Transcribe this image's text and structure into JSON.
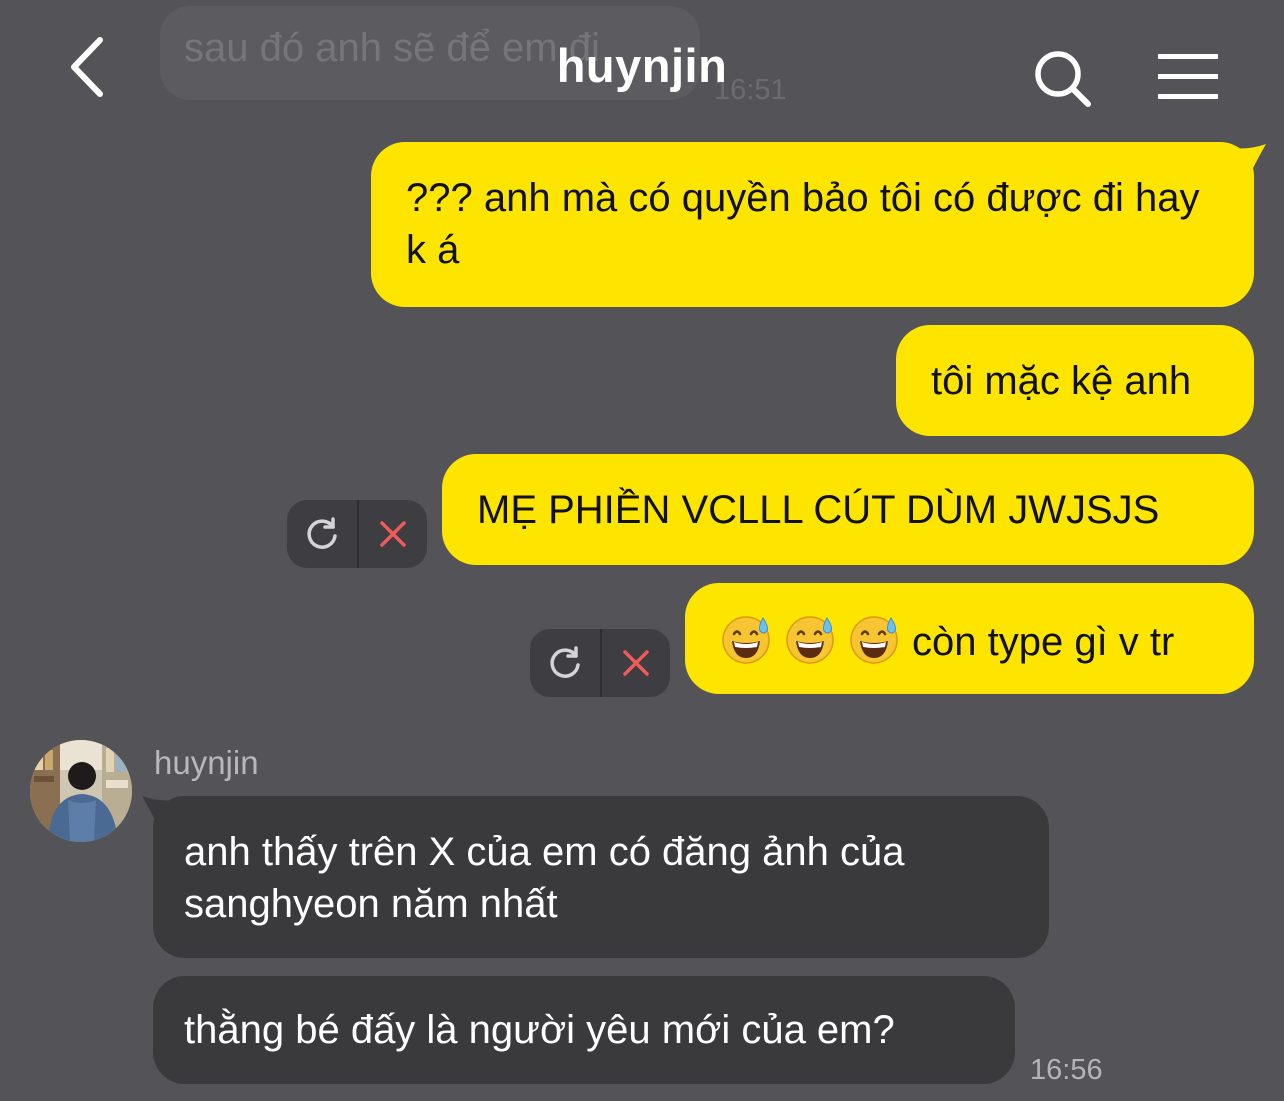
{
  "header": {
    "title": "huynjin",
    "back_icon": "chevron-left-icon",
    "search_icon": "search-icon",
    "menu_icon": "hamburger-menu-icon"
  },
  "previous_message": {
    "text": "sau đó anh sẽ để em đi",
    "time": "16:51"
  },
  "outgoing": [
    {
      "text": "??? anh mà có quyền bảo tôi có được đi hay k á",
      "failed": false
    },
    {
      "text": "tôi mặc kệ anh",
      "failed": false
    },
    {
      "text": "MẸ PHIỀN VCLLL CÚT DÙM JWJSJS",
      "failed": true
    },
    {
      "emoji": [
        "grinning-sweat-emoji",
        "grinning-sweat-emoji",
        "grinning-sweat-emoji"
      ],
      "text": "còn type gì v tr",
      "failed": true
    }
  ],
  "failed_controls": {
    "retry_icon": "retry-icon",
    "delete_icon": "delete-x-icon"
  },
  "incoming": {
    "sender": "huynjin",
    "messages": [
      {
        "text": "anh thấy trên X của em có đăng ảnh của sanghyeon năm nhất"
      },
      {
        "text": "thằng bé đấy là người yêu mới của em?"
      }
    ],
    "time": "16:56"
  },
  "colors": {
    "background": "#545357",
    "outgoing_bubble": "#fee500",
    "incoming_bubble": "#3a3a3c",
    "delete_icon": "#ef5a5a"
  }
}
